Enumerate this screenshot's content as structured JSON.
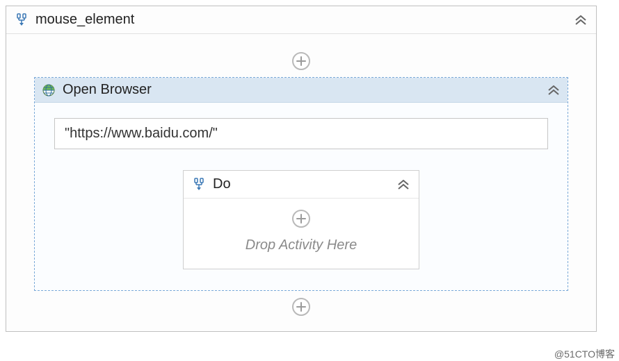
{
  "sequence": {
    "title": "mouse_element",
    "child": {
      "open_browser": {
        "title": "Open Browser",
        "url": "\"https://www.baidu.com/\"",
        "do": {
          "title": "Do",
          "drop_hint": "Drop Activity Here"
        }
      }
    }
  },
  "watermark": "@51CTO博客"
}
